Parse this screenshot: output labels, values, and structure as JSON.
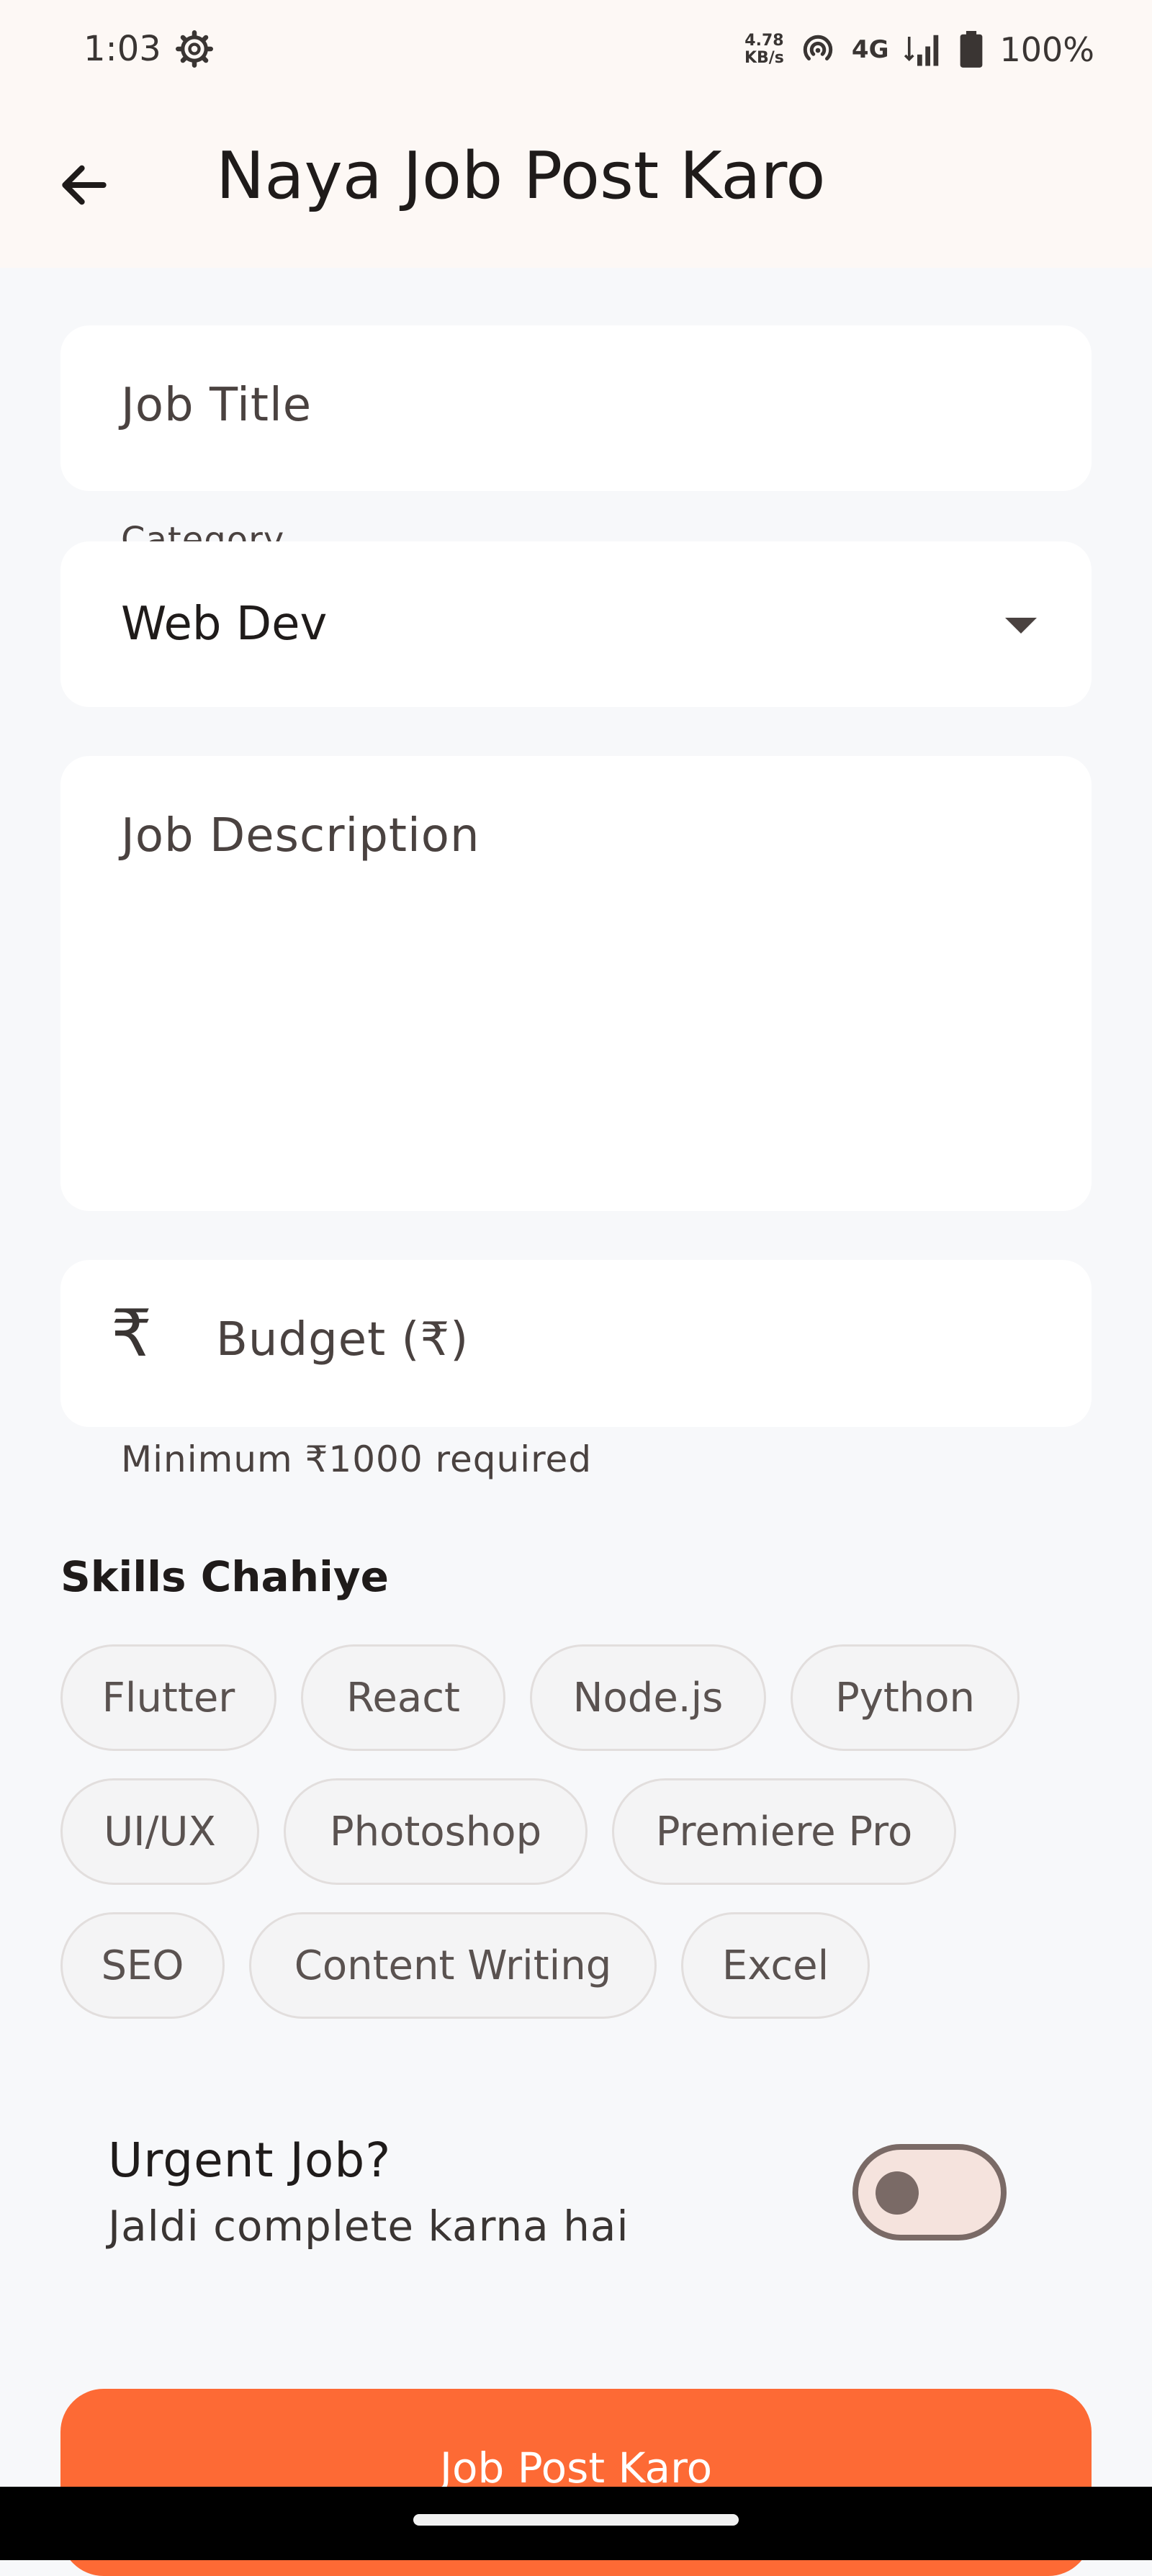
{
  "status_bar": {
    "time": "1:03",
    "speed_value": "4.78",
    "speed_unit": "KB/s",
    "network": "4G",
    "battery": "100%"
  },
  "app_bar": {
    "title": "Naya Job Post Karo"
  },
  "form": {
    "job_title_placeholder": "Job Title",
    "category_label": "Category",
    "category_value": "Web Dev",
    "description_placeholder": "Job Description",
    "budget_placeholder": "Budget (₹)",
    "budget_helper": "Minimum ₹1000 required"
  },
  "skills": {
    "title": "Skills Chahiye",
    "items": [
      "Flutter",
      "React",
      "Node.js",
      "Python",
      "UI/UX",
      "Photoshop",
      "Premiere Pro",
      "SEO",
      "Content Writing",
      "Excel"
    ]
  },
  "urgent": {
    "title": "Urgent Job?",
    "subtitle": "Jaldi complete karna hai",
    "enabled": false
  },
  "submit": {
    "label": "Job Post Karo"
  },
  "colors": {
    "accent": "#fd6a35",
    "background": "#f7f8fa",
    "header": "#fdf8f5"
  },
  "icons": {
    "back": "arrow-left-icon",
    "currency": "rupee-icon",
    "dropdown": "dropdown-arrow-icon",
    "status_settings": "gear-icon"
  }
}
